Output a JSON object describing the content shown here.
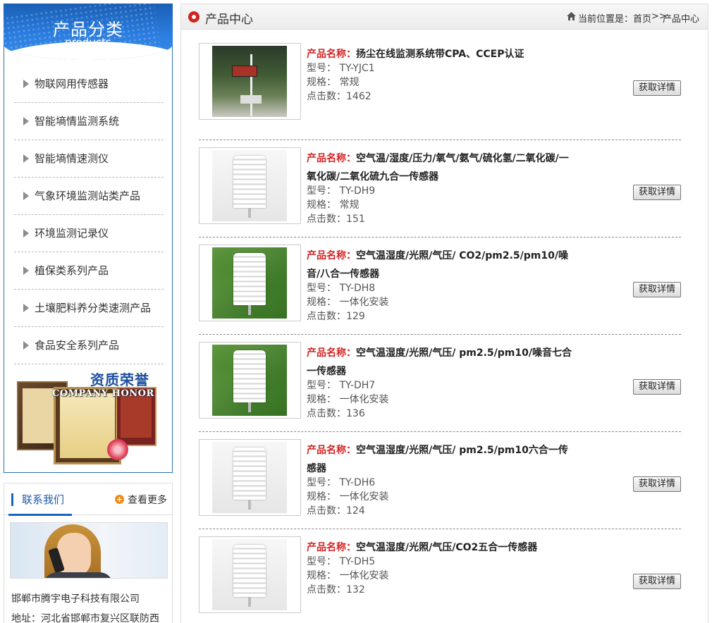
{
  "sidebar": {
    "title": "产品分类",
    "subtitle": "products",
    "categories": [
      "物联网用传感器",
      "智能墒情监测系统",
      "智能墒情速测仪",
      "气象环境监测站类产品",
      "环境监测记录仪",
      "植保类系列产品",
      "土壤肥料养分类速测产品",
      "食品安全系列产品"
    ],
    "honor_cn": "资质荣誉",
    "honor_en": "COMPANY HONOR"
  },
  "contact": {
    "title": "联系我们",
    "more_label": "查看更多",
    "more_icon": "plus-circle-icon",
    "company": "邯郸市腾宇电子科技有限公司",
    "address": "地址：河北省邯郸市复兴区联防西"
  },
  "main": {
    "title": "产品中心",
    "breadcrumb": {
      "prefix": "当前位置是：",
      "home": "首页",
      "separator": ">>",
      "current": "产品中心"
    },
    "labels": {
      "name": "产品名称：",
      "model": "型号：",
      "spec": "规格：",
      "clicks": "点击数："
    },
    "button_label": "获取详情",
    "products": [
      {
        "name": "扬尘在线监测系统带CPA、CCEP认证",
        "model": "TY-YJC1",
        "spec": "常规",
        "clicks": "1462"
      },
      {
        "name": "空气温/湿度/压力/氧气/氨气/硫化氢/二氧化碳/一氧化碳/二氧化硫九合一传感器",
        "model": "TY-DH9",
        "spec": "常规",
        "clicks": "151"
      },
      {
        "name": "空气温湿度/光照/气压/ CO2/pm2.5/pm10/噪音/八合一传感器",
        "model": "TY-DH8",
        "spec": "一体化安装",
        "clicks": "129"
      },
      {
        "name": "空气温湿度/光照/气压/ pm2.5/pm10/噪音七合一传感器",
        "model": "TY-DH7",
        "spec": "一体化安装",
        "clicks": "136"
      },
      {
        "name": "空气温湿度/光照/气压/ pm2.5/pm10六合一传感器",
        "model": "TY-DH6",
        "spec": "一体化安装",
        "clicks": "124"
      },
      {
        "name": "空气温湿度/光照/气压/CO2五合一传感器",
        "model": "TY-DH5",
        "spec": "一体化安装",
        "clicks": "132"
      }
    ]
  },
  "colors": {
    "brand_blue": "#1e5aa8",
    "label_red": "#d42222",
    "accent_orange": "#f08c1a"
  }
}
